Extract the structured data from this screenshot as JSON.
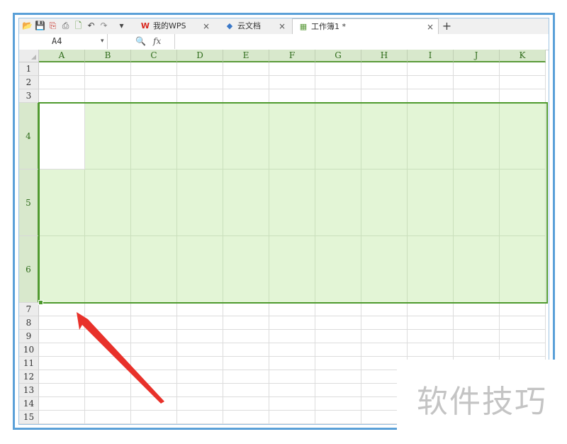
{
  "quick_access": [
    {
      "name": "open-folder-icon",
      "glyph": "📂",
      "color": "#e08a1e"
    },
    {
      "name": "save-icon",
      "glyph": "💾",
      "color": "#3b7fc4"
    },
    {
      "name": "export-pdf-icon",
      "glyph": "⎘",
      "color": "#c8352b"
    },
    {
      "name": "print-icon",
      "glyph": "⎙",
      "color": "#555555"
    },
    {
      "name": "print-preview-icon",
      "glyph": "🗋",
      "color": "#4a8c2a"
    },
    {
      "name": "undo-icon",
      "glyph": "↶",
      "color": "#444444"
    },
    {
      "name": "redo-icon",
      "glyph": "↷",
      "color": "#888888"
    },
    {
      "name": "customize-dropdown-icon",
      "glyph": "▾",
      "color": "#444444"
    }
  ],
  "tabs": [
    {
      "name": "tab-my-wps",
      "label": "我的WPS",
      "icon_name": "wps-logo-icon",
      "glyph": "W",
      "icon_color": "#d9251c",
      "active": false
    },
    {
      "name": "tab-cloud-docs",
      "label": "云文档",
      "icon_name": "cloud-doc-icon",
      "glyph": "◆",
      "icon_color": "#3a78c8",
      "active": false
    },
    {
      "name": "tab-workbook",
      "label": "工作簿1 *",
      "icon_name": "spreadsheet-icon",
      "glyph": "▦",
      "icon_color": "#5b9a3b",
      "active": true
    }
  ],
  "tab_close_glyph": "×",
  "new_tab_glyph": "+",
  "formula_bar": {
    "cell_reference": "A4",
    "dropdown_glyph": "▾",
    "zoom_glyph": "🔍",
    "fx_label": "fx",
    "formula_value": ""
  },
  "columns": [
    "A",
    "B",
    "C",
    "D",
    "E",
    "F",
    "G",
    "H",
    "I",
    "J",
    "K"
  ],
  "rows": [
    "1",
    "2",
    "3",
    "4",
    "5",
    "6",
    "7",
    "8",
    "9",
    "10",
    "11",
    "12",
    "13",
    "14",
    "15"
  ],
  "selection": {
    "range": "A4:K6",
    "active_cell": "A4"
  },
  "watermark": {
    "text": "软件技巧"
  },
  "colors": {
    "accent": "#4e9a2e",
    "selection_fill": "#e3f5d6",
    "annotation_arrow": "#e8312a",
    "frame_border": "#5aa0d8"
  }
}
